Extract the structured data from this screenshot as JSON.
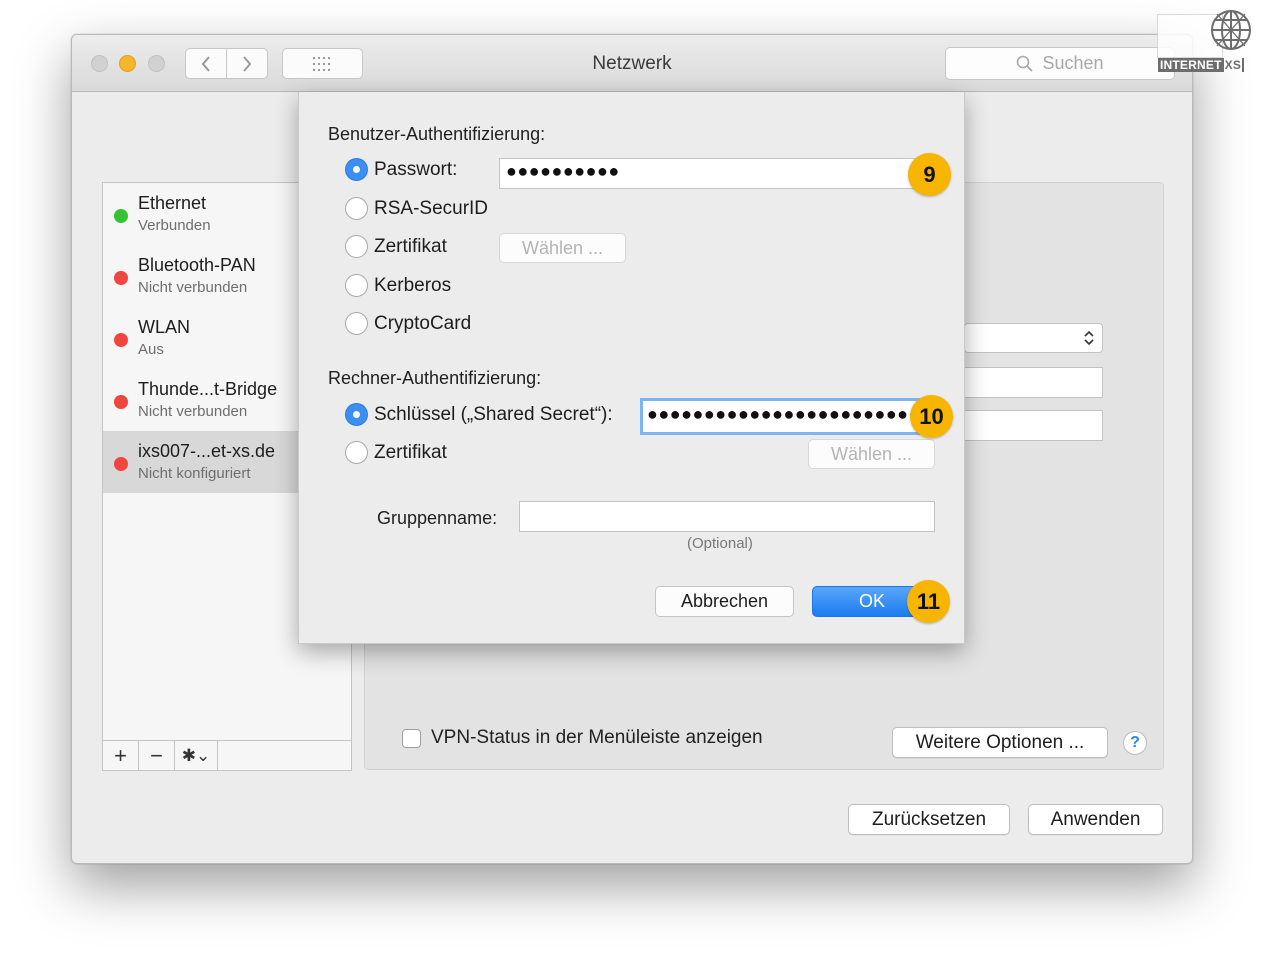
{
  "window": {
    "title": "Netzwerk"
  },
  "search": {
    "placeholder": "Suchen"
  },
  "sidebar": {
    "items": [
      {
        "name": "Ethernet",
        "status": "Verbunden",
        "color": "#35c334"
      },
      {
        "name": "Bluetooth-PAN",
        "status": "Nicht verbunden",
        "color": "#f2453d"
      },
      {
        "name": "WLAN",
        "status": "Aus",
        "color": "#f2453d"
      },
      {
        "name": "Thunde...t-Bridge",
        "status": "Nicht verbunden",
        "color": "#f2453d"
      },
      {
        "name": "ixs007-...et-xs.de",
        "status": "Nicht konfiguriert",
        "color": "#f2453d",
        "selected": true
      }
    ],
    "tools": {
      "add": "+",
      "remove": "−",
      "gear": "✱⌄"
    }
  },
  "panel": {
    "vpn_checkbox_label": "VPN-Status in der Menüleiste anzeigen",
    "more_options_label": "Weitere Optionen ...",
    "help_label": "?",
    "revert_label": "Zurücksetzen",
    "apply_label": "Anwenden"
  },
  "dialog": {
    "user_auth_heading": "Benutzer-Authentifizierung:",
    "user_auth_options": [
      "Passwort:",
      "RSA-SecurID",
      "Zertifikat",
      "Kerberos",
      "CryptoCard"
    ],
    "user_auth_selected": "Passwort:",
    "password_value": "●●●●●●●●●●",
    "choose_label": "Wählen ...",
    "machine_auth_heading": "Rechner-Authentifizierung:",
    "machine_auth_options": [
      "Schlüssel („Shared Secret“):",
      "Zertifikat"
    ],
    "machine_auth_selected": "Schlüssel („Shared Secret“):",
    "shared_secret_value": "●●●●●●●●●●●●●●●●●●●●●●●●●",
    "group_name_label": "Gruppenname:",
    "group_name_value": "",
    "optional_hint": "(Optional)",
    "cancel_label": "Abbrechen",
    "ok_label": "OK"
  },
  "callouts": [
    "9",
    "10",
    "11"
  ],
  "logo": {
    "text": "INTERNET",
    "suffix": "XS"
  },
  "colors": {
    "accent_blue": "#1c7cf1",
    "badge_yellow": "#f7b500",
    "status_green": "#35c334",
    "status_red": "#f2453d"
  }
}
